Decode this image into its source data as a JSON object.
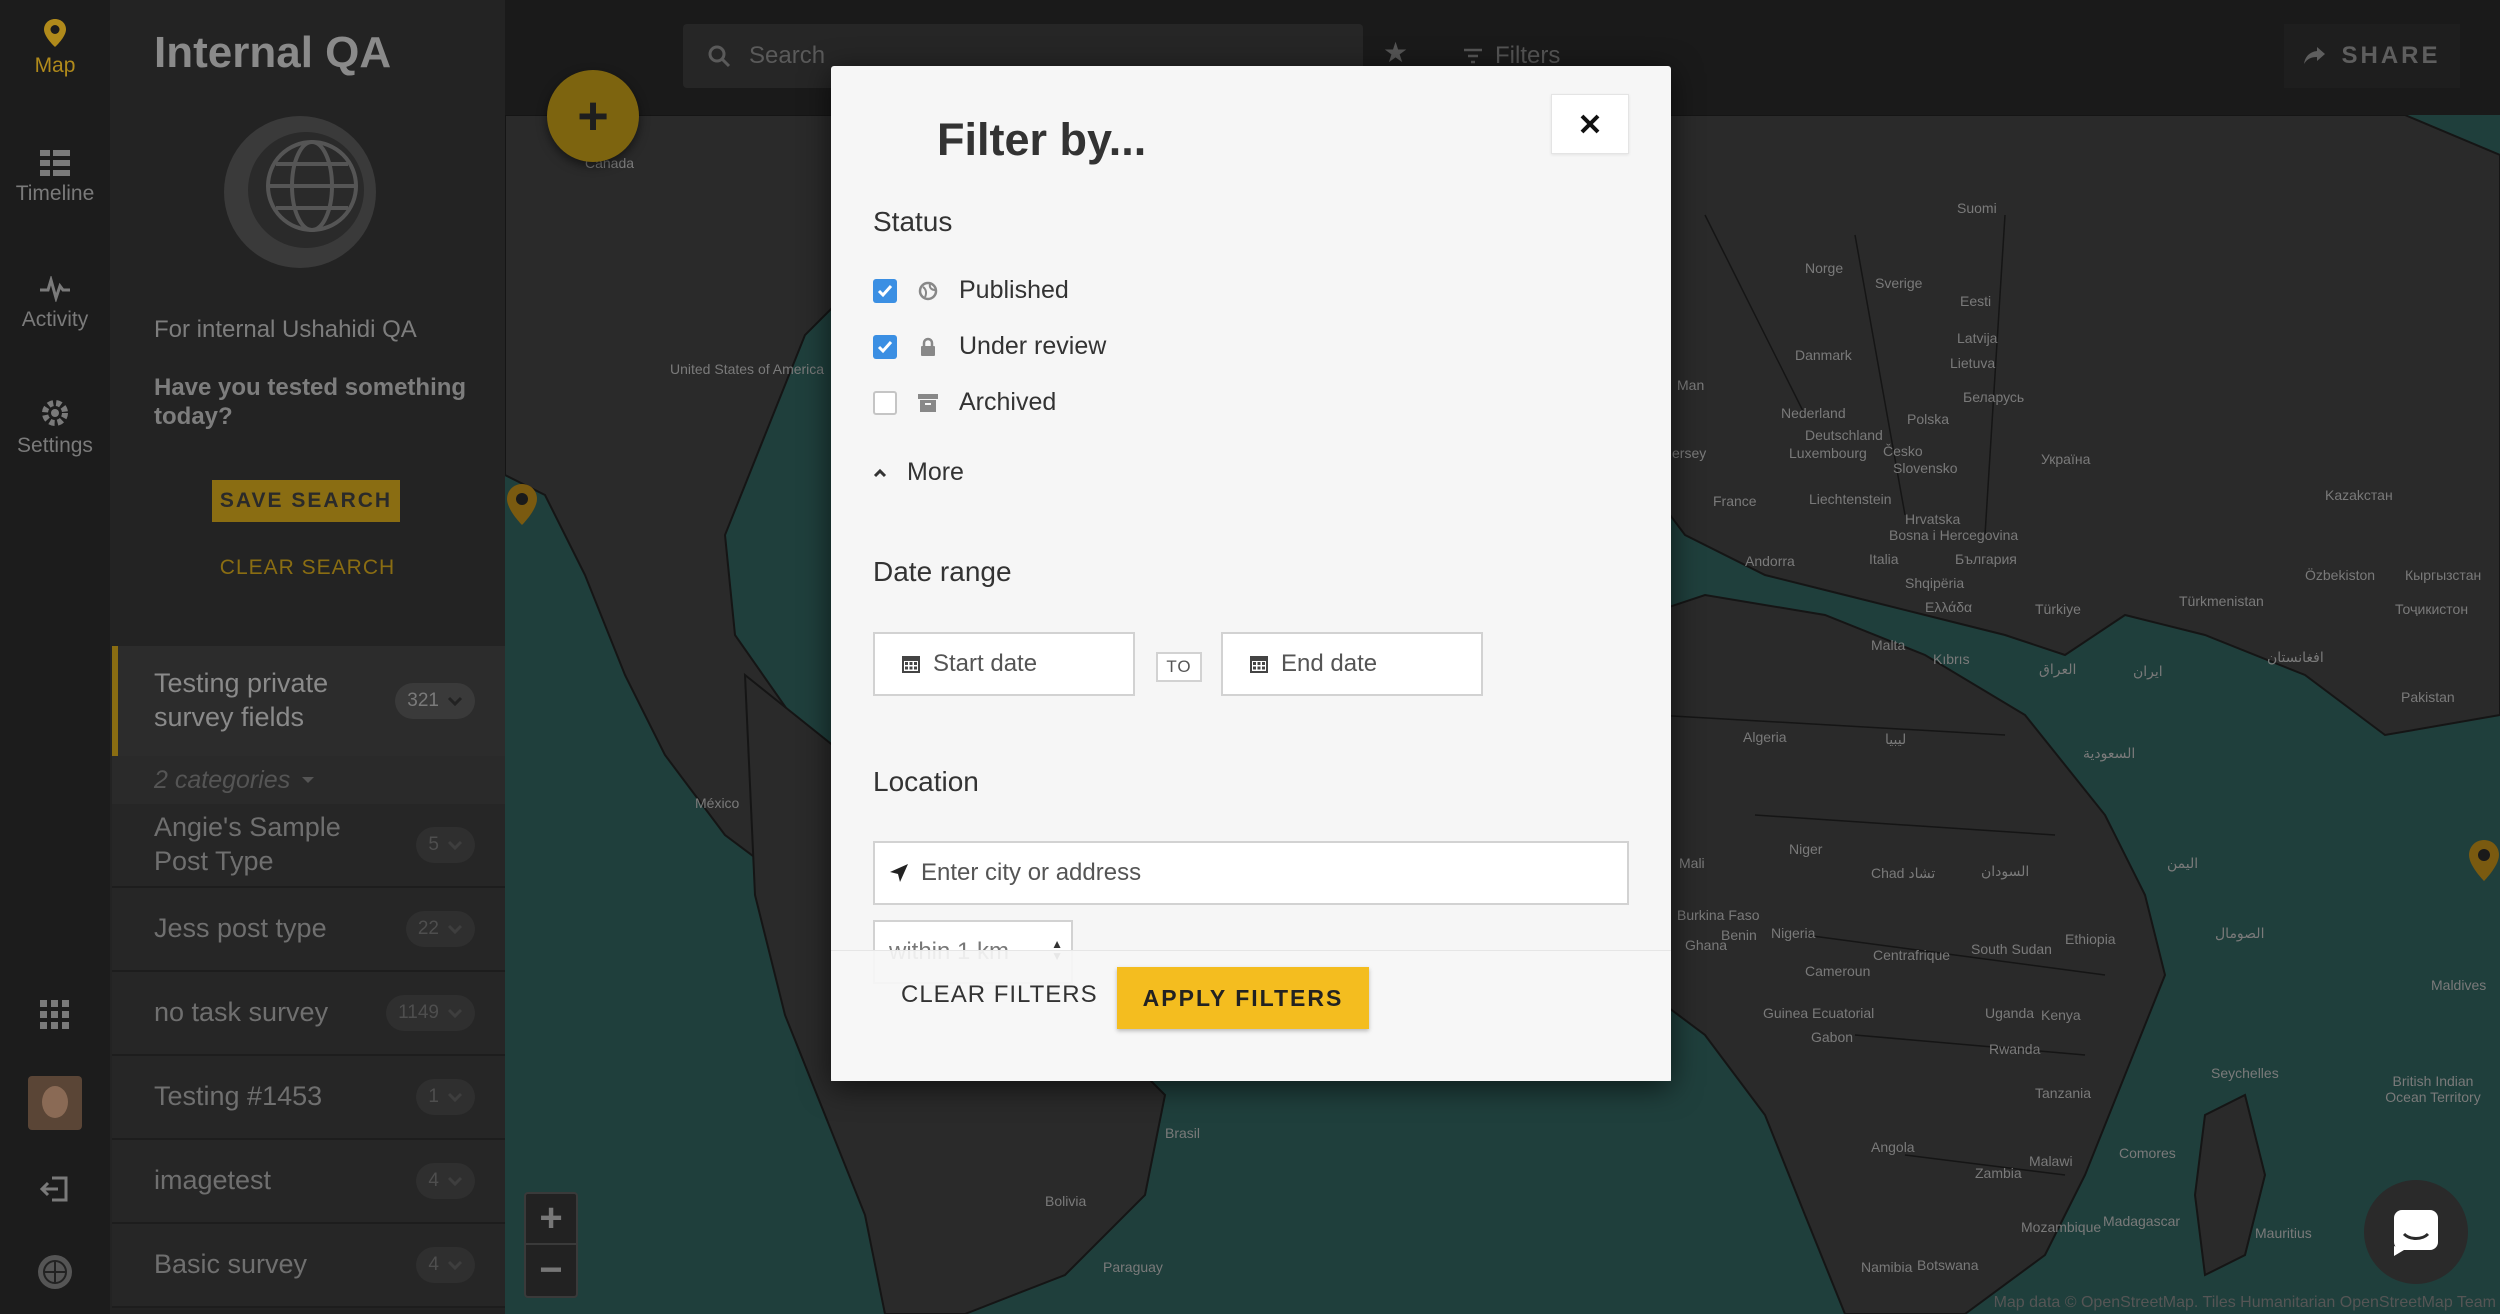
{
  "nav": {
    "items": [
      {
        "label": "Map",
        "icon": "map-pin-icon"
      },
      {
        "label": "Timeline",
        "icon": "timeline-icon"
      },
      {
        "label": "Activity",
        "icon": "activity-icon"
      },
      {
        "label": "Settings",
        "icon": "gear-icon"
      }
    ],
    "active_color": "#b08a1b"
  },
  "sidebar": {
    "title": "Internal QA",
    "description": "For internal Ushahidi QA",
    "question": "Have you tested something today?",
    "save_search": "SAVE SEARCH",
    "clear_search": "CLEAR SEARCH",
    "categories": "2 categories",
    "surveys": [
      {
        "name": "Testing private survey fields",
        "count": "321"
      },
      {
        "name": "Angie's Sample Post Type",
        "count": "5"
      },
      {
        "name": "Jess post type",
        "count": "22"
      },
      {
        "name": "no task survey",
        "count": "1149"
      },
      {
        "name": "Testing #1453",
        "count": "1"
      },
      {
        "name": "imagetest",
        "count": "4"
      },
      {
        "name": "Basic survey",
        "count": "4"
      }
    ]
  },
  "topbar": {
    "search_placeholder": "Search",
    "filters": "Filters",
    "share": "SHARE"
  },
  "map": {
    "labels": [
      "Canada",
      "United States of America",
      "México",
      "Brasil",
      "Bolivia",
      "Paraguay",
      "Suomi",
      "Norge",
      "Sverige",
      "Eesti",
      "Latvija",
      "Lietuva",
      "Danmark",
      "Nederland",
      "Deutschland",
      "Polska",
      "Беларусь",
      "Україна",
      "France",
      "Česko",
      "Slovensko",
      "Liechtenstein",
      "Hrvatska",
      "Bosna i Hercegovina",
      "България",
      "Andorra",
      "Italia",
      "Shqipëria",
      "Ελλάδα",
      "Türkiye",
      "Kazakстан",
      "Malta",
      "Algeria",
      "ليبيا",
      "Niger",
      "Chad تشاد",
      "السودان",
      "Mali",
      "Nigeria",
      "Cameroun",
      "Centrafrique",
      "South Sudan",
      "Ethiopia",
      "Gabon",
      "Uganda",
      "Kenya",
      "Rwanda",
      "Tanzania",
      "Angola",
      "Zambia",
      "Malawi",
      "Namibia",
      "Botswana",
      "Mozambique",
      "Madagascar",
      "Comores",
      "Seychelles",
      "Maldives",
      "Mauritius",
      "Guinea Ecuatorial",
      "Ghana",
      "Benin",
      "Burkina Faso",
      "ایران",
      "العراق",
      "افغانستان",
      "Pakistan",
      "Özbekiston",
      "Türkmenistan",
      "Кыргызстан",
      "Тоҷикистон",
      "Kıbrıs",
      "British Indian Ocean Territory",
      "السعودية",
      "اليمن",
      "الصومال",
      "Luxembourg",
      "Jersey",
      "Man"
    ],
    "attribution": "Map data © OpenStreetMap. Tiles Humanitarian OpenStreetMap Team",
    "water_color": "#1f3f3c"
  },
  "modal": {
    "title": "Filter by...",
    "status_label": "Status",
    "statuses": [
      {
        "label": "Published",
        "checked": true,
        "icon": "globe-icon"
      },
      {
        "label": "Under review",
        "checked": true,
        "icon": "lock-icon"
      },
      {
        "label": "Archived",
        "checked": false,
        "icon": "archive-icon"
      }
    ],
    "more": "More",
    "date_label": "Date range",
    "start_date": "Start date",
    "to": "TO",
    "end_date": "End date",
    "location_label": "Location",
    "location_placeholder": "Enter city or address",
    "within": "within 1 km",
    "clear_filters": "CLEAR FILTERS",
    "apply_filters": "APPLY FILTERS",
    "accent": "#f4bd1f",
    "checkbox_color": "#3b8fe3"
  }
}
